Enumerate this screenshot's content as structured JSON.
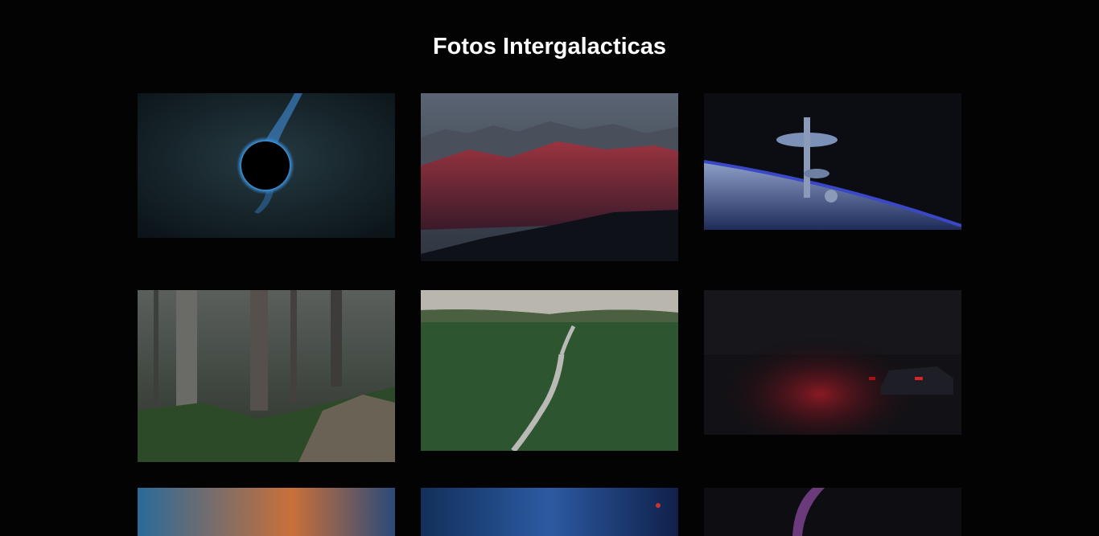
{
  "page": {
    "title": "Fotos Intergalacticas"
  },
  "gallery": {
    "photos": [
      {
        "name": "black-hole",
        "color": "#1a2a33"
      },
      {
        "name": "red-mountains",
        "color": "#7a2a35"
      },
      {
        "name": "space-station",
        "color": "#2a3f7a"
      },
      {
        "name": "misty-forest",
        "color": "#3a4a38"
      },
      {
        "name": "forest-road",
        "color": "#2f5a2f"
      },
      {
        "name": "dark-car-smoke",
        "color": "#3a1015"
      },
      {
        "name": "planet-earth",
        "color": "#c05a20"
      },
      {
        "name": "nebula",
        "color": "#1f3f7a"
      },
      {
        "name": "purple-planet",
        "color": "#5a2a6a"
      }
    ]
  }
}
